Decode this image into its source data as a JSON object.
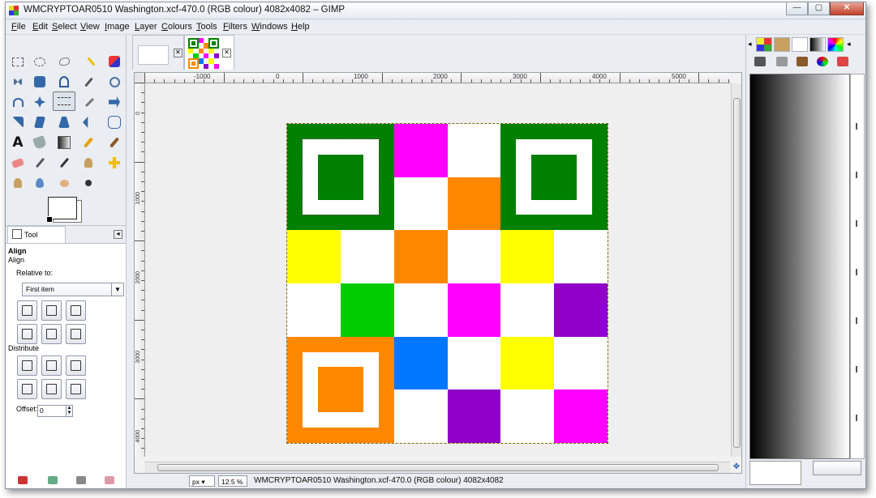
{
  "window": {
    "title": "WMCRYPTOAR0510 Washington.xcf-470.0 (RGB colour) 4082x4082 – GIMP",
    "buttons": {
      "minimize": "—",
      "maximize": "▢",
      "close": "✕"
    }
  },
  "menu": [
    "File",
    "Edit",
    "Select",
    "View",
    "Image",
    "Layer",
    "Colours",
    "Tools",
    "Filters",
    "Windows",
    "Help"
  ],
  "tool_options": {
    "tab_label": "Tool Options",
    "header": "Align",
    "subheader": "Align",
    "relative_to_label": "Relative to:",
    "relative_to_value": "First item",
    "distribute_label": "Distribute",
    "offset_label": "Offset:",
    "offset_value": "0"
  },
  "image_tabs": [
    {
      "label": "",
      "type": "empty"
    },
    {
      "label": "",
      "type": "qr-thumbnail"
    }
  ],
  "ruler": {
    "top_labels": [
      "-1000",
      "0",
      "1000",
      "2000",
      "3000",
      "4000",
      "5000"
    ],
    "left_labels": [
      "0",
      "1000",
      "2000",
      "3000",
      "4000"
    ]
  },
  "status": {
    "unit": "px",
    "zoom": "12.5 %",
    "text": "WMCRYPTOAR0510 Washington.xcf-470.0 (RGB colour) 4082x4082"
  },
  "image_grid": [
    [
      "F",
      "F",
      "magenta",
      "white",
      "G",
      "G"
    ],
    [
      "F",
      "F",
      "white",
      "orange",
      "G",
      "G"
    ],
    [
      "yellow",
      "white",
      "orange",
      "white",
      "yellow",
      "white"
    ],
    [
      "white",
      "green",
      "white",
      "magenta",
      "white",
      "purple"
    ],
    [
      "O",
      "O",
      "blue",
      "white",
      "yellow",
      "white"
    ],
    [
      "O",
      "O",
      "white",
      "purple",
      "white",
      "magenta"
    ]
  ],
  "colors": {
    "magenta": "#ff00ff",
    "white": "#ffffff",
    "orange": "#ff8800",
    "yellow": "#ffff00",
    "green": "#00cc00",
    "purple": "#9100c8",
    "blue": "#0077ff",
    "dark_green": "#008000",
    "finder_orange": "#ff8800"
  }
}
